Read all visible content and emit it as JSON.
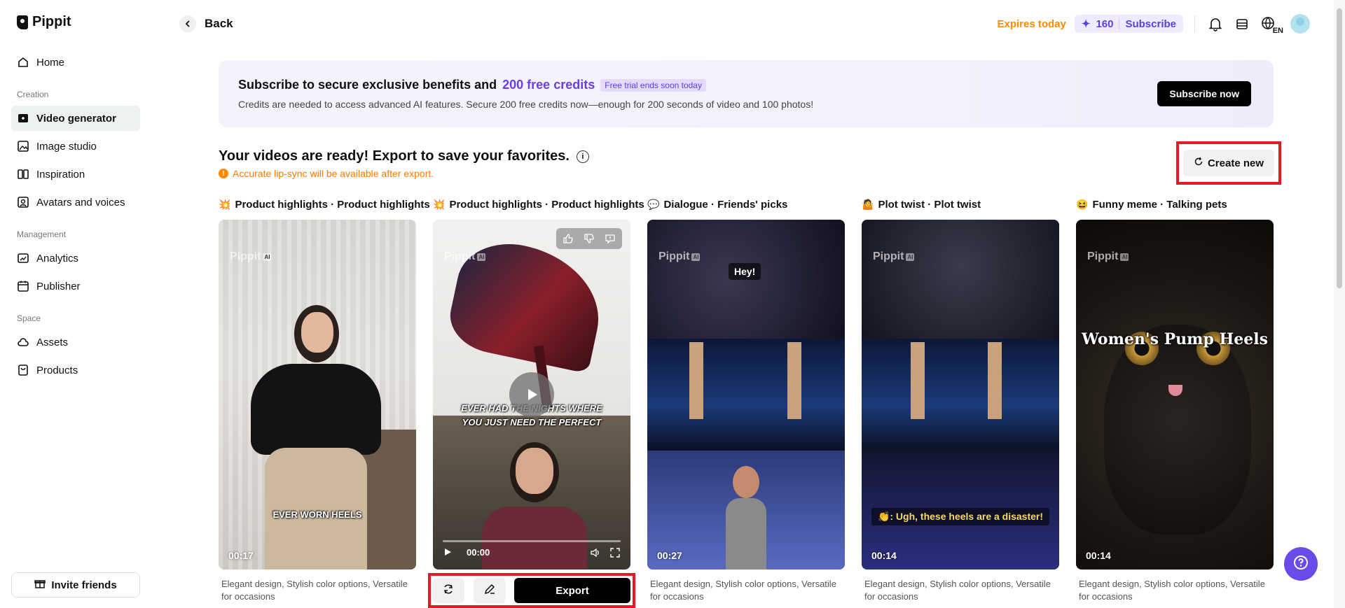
{
  "brand": {
    "name": "Pippit"
  },
  "sidebar": {
    "home": "Home",
    "section_creation": "Creation",
    "video_generator": "Video generator",
    "image_studio": "Image studio",
    "inspiration": "Inspiration",
    "avatars_voices": "Avatars and voices",
    "section_management": "Management",
    "analytics": "Analytics",
    "publisher": "Publisher",
    "section_space": "Space",
    "assets": "Assets",
    "products": "Products",
    "invite": "Invite friends"
  },
  "header": {
    "back": "Back",
    "expires": "Expires today",
    "credits": "160",
    "subscribe": "Subscribe",
    "lang": "EN"
  },
  "banner": {
    "title_pre": "Subscribe to secure exclusive benefits and",
    "title_highlight": "200 free credits",
    "trial_badge": "Free trial ends soon today",
    "subtitle": "Credits are needed to access advanced AI features. Secure 200 free credits now—enough for 200 seconds of video and 100 photos!",
    "cta": "Subscribe now"
  },
  "main": {
    "title": "Your videos are ready! Export to save your favorites.",
    "warning": "Accurate lip-sync will be available after export.",
    "create_new": "Create new",
    "export": "Export",
    "watermark": "Pippit",
    "watermark_ai": "AI"
  },
  "videos": [
    {
      "emoji": "💥",
      "title": "Product highlights · Product highlights",
      "duration": "00:17",
      "caption": "EVER WORN HEELS",
      "desc": "Elegant design, Stylish color options, Versatile for occasions"
    },
    {
      "emoji": "💥",
      "title": "Product highlights · Product highlights",
      "time": "00:00",
      "caption": "EVER HAD THE NIGHTS WHERE YOU JUST NEED THE PERFECT",
      "desc": ""
    },
    {
      "emoji": "💬",
      "title": "Dialogue · Friends' picks",
      "duration": "00:27",
      "caption": "Hey!",
      "desc": "Elegant design, Stylish color options, Versatile for occasions"
    },
    {
      "emoji": "🤷",
      "title": "Plot twist · Plot twist",
      "duration": "00:14",
      "caption": "👏: Ugh, these heels are a disaster!",
      "desc": "Elegant design, Stylish color options, Versatile for occasions"
    },
    {
      "emoji": "😆",
      "title": "Funny meme · Talking pets",
      "duration": "00:14",
      "caption": "Women's Pump Heels",
      "desc": "Elegant design, Stylish color options, Versatile for occasions"
    }
  ]
}
